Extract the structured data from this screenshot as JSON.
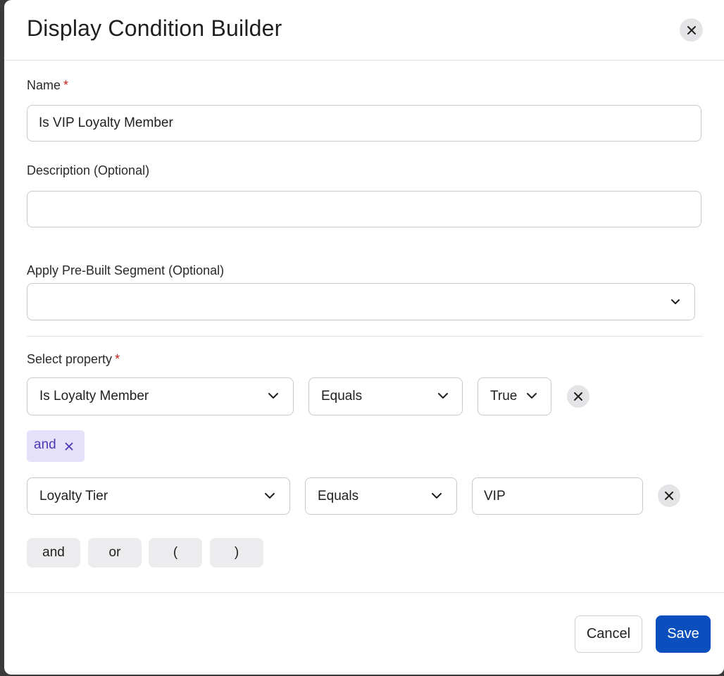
{
  "dialog": {
    "title": "Display Condition Builder"
  },
  "form": {
    "name_label": "Name",
    "required_marker": "*",
    "name_value": "Is VIP Loyalty Member",
    "description_label": "Description (Optional)",
    "description_value": "",
    "segment_label": "Apply Pre-Built Segment (Optional)",
    "segment_value": "",
    "property_label": "Select property"
  },
  "conditions": [
    {
      "property": "Is Loyalty Member",
      "operator": "Equals",
      "value": "True"
    },
    {
      "property": "Loyalty Tier",
      "operator": "Equals",
      "value": "VIP"
    }
  ],
  "connector": {
    "label": "and"
  },
  "logic_buttons": [
    "and",
    "or",
    "(",
    ")"
  ],
  "footer": {
    "cancel_label": "Cancel",
    "save_label": "Save"
  },
  "colors": {
    "primary": "#0a4fbd",
    "required": "#c0231c",
    "chip_bg": "#e6e1fb",
    "chip_text": "#4a3bb5"
  },
  "icons": {
    "close": "close-icon",
    "chevron": "chevron-down-icon",
    "remove": "remove-icon"
  }
}
